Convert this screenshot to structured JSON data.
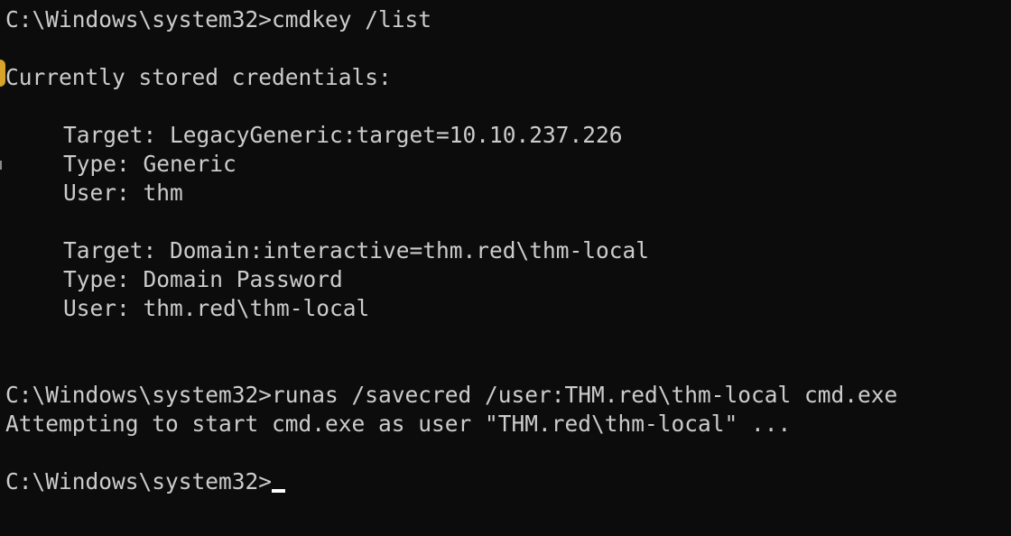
{
  "terminal": {
    "lines": [
      "C:\\Windows\\system32>cmdkey /list",
      "",
      "Currently stored credentials:",
      "",
      "Target: LegacyGeneric:target=10.10.237.226",
      "Type: Generic",
      "User: thm",
      "",
      "Target: Domain:interactive=thm.red\\thm-local",
      "Type: Domain Password",
      "User: thm.red\\thm-local",
      "",
      "",
      "C:\\Windows\\system32>runas /savecred /user:THM.red\\thm-local cmd.exe",
      "Attempting to start cmd.exe as user \"THM.red\\thm-local\" ...",
      "",
      "C:\\Windows\\system32>"
    ]
  },
  "colors": {
    "background": "#0c0c0c",
    "foreground": "#cccccc",
    "cursor": "#ffffff"
  }
}
